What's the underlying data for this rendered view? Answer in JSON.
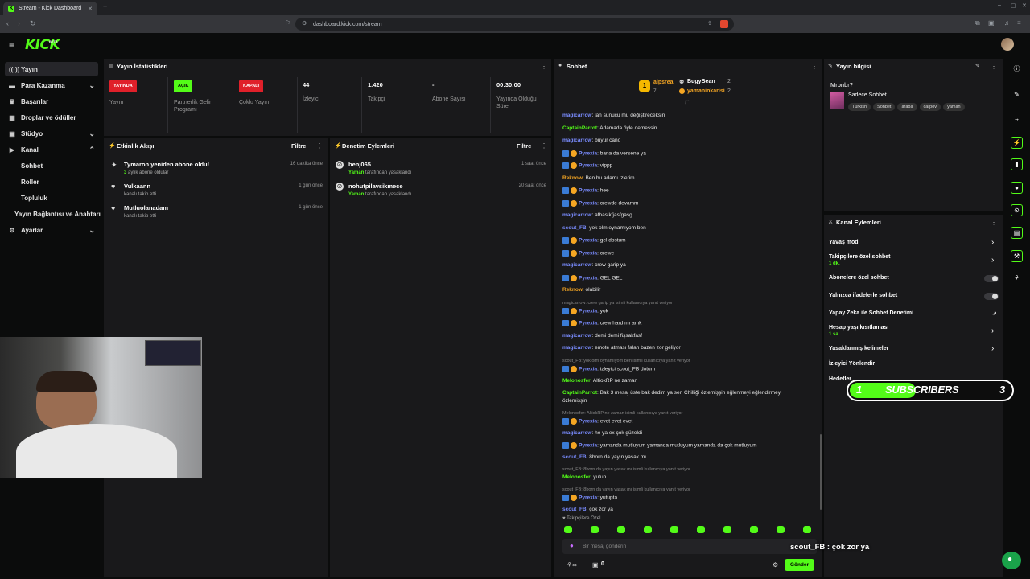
{
  "browser": {
    "tab_title": "Stream - Kick Dashboard",
    "url": "dashboard.kick.com/stream"
  },
  "brand": {
    "logo": "KICK",
    "accent": "#53fc18"
  },
  "sidebar": {
    "items": [
      {
        "label": "Yayın",
        "icon": "broadcast-icon"
      },
      {
        "label": "Para Kazanma",
        "icon": "money-icon"
      },
      {
        "label": "Başarılar",
        "icon": "trophy-icon"
      },
      {
        "label": "Droplar ve ödüller",
        "icon": "gift-icon"
      },
      {
        "label": "Stüdyo",
        "icon": "studio-icon"
      },
      {
        "label": "Kanal",
        "icon": "channel-icon"
      },
      {
        "label": "Ayarlar",
        "icon": "gear-icon"
      }
    ],
    "sub": [
      "Sohbet",
      "Roller",
      "Topluluk",
      "Yayın Bağlantısı ve Anahtarı"
    ]
  },
  "stats": {
    "title": "Yayın İstatistikleri",
    "items": [
      {
        "value": "YAYINDA",
        "label": "Yayın"
      },
      {
        "value": "AÇIK",
        "label": "Partnerlik Gelir Programı"
      },
      {
        "value": "KAPALI",
        "label": "Çoklu Yayın"
      },
      {
        "value": "44",
        "label": "İzleyici"
      },
      {
        "value": "1.420",
        "label": "Takipçi"
      },
      {
        "value": "-",
        "label": "Abone Sayısı"
      },
      {
        "value": "00:30:00",
        "label": "Yayında Olduğu Süre"
      }
    ]
  },
  "activity": {
    "title": "Etkinlik Akışı",
    "filter": "Filtre",
    "items": [
      {
        "name": "Tymaron yeniden abone oldu!",
        "sub_num": "3",
        "sub": " aylık abone oldular",
        "time": "16 dakika önce"
      },
      {
        "name": "Vulkaann",
        "sub": "kanalı takip etti",
        "time": "1 gün önce"
      },
      {
        "name": "Mutluolanadam",
        "sub": "kanalı takip etti",
        "time": "1 gün önce"
      }
    ]
  },
  "moderation": {
    "title": "Denetim Eylemleri",
    "filter": "Filtre",
    "items": [
      {
        "name": "benj065",
        "by": "Yaman",
        "sub": " tarafından yasaklandı",
        "time": "1 saat önce"
      },
      {
        "name": "nohutpilavsikmece",
        "by": "Yaman",
        "sub": " tarafından yasaklandı",
        "time": "20 saat önce"
      }
    ]
  },
  "chat": {
    "title": "Sohbet",
    "leaders": [
      {
        "rank": "1",
        "name": "alpsreal",
        "count": "7"
      },
      {
        "name": "BugyBean",
        "count": "2"
      },
      {
        "name": "yamaninkarisi",
        "count": "2"
      }
    ],
    "messages": [
      {
        "u": "magicarrow",
        "c": "#7a8cff",
        "t": ": lan sunucu mu değiştireceksin"
      },
      {
        "u": "CaptainParrot",
        "c": "#53fc18",
        "t": ": Adamada öyle demessin"
      },
      {
        "u": "magicarrow",
        "c": "#7a8cff",
        "t": ": buyur cano"
      },
      {
        "u": "Pyrexia",
        "c": "#7a8cff",
        "t": ": bana da versene ya",
        "b": true
      },
      {
        "u": "Pyrexia",
        "c": "#7a8cff",
        "t": ": vippp",
        "b": true
      },
      {
        "u": "Reknow",
        "c": "#f5a623",
        "t": ": Ben bu adamı izlerim"
      },
      {
        "u": "Pyrexia",
        "c": "#7a8cff",
        "t": ": hee",
        "b": true
      },
      {
        "u": "Pyrexia",
        "c": "#7a8cff",
        "t": ": crewde devamm",
        "b": true
      },
      {
        "u": "magicarrow",
        "c": "#7a8cff",
        "t": ": afhasikfjasfgasg"
      },
      {
        "u": "scout_FB",
        "c": "#7a8cff",
        "t": ": yok olm oynamıyom ben"
      },
      {
        "u": "Pyrexia",
        "c": "#7a8cff",
        "t": ": gel dostum",
        "b": true
      },
      {
        "u": "Pyrexia",
        "c": "#7a8cff",
        "t": ": crewe",
        "b": true
      },
      {
        "u": "magicarrow",
        "c": "#7a8cff",
        "t": ": crew garip ya"
      },
      {
        "u": "Pyrexia",
        "c": "#7a8cff",
        "t": ": GEL GEL",
        "b": true
      },
      {
        "u": "Reknow",
        "c": "#f5a623",
        "t": ": olabilir"
      },
      {
        "reply": "magicarrow: crew garip ya isimli kullanıcıya yanıt veriyor"
      },
      {
        "u": "Pyrexia",
        "c": "#7a8cff",
        "t": ": yok",
        "b": true
      },
      {
        "u": "Pyrexia",
        "c": "#7a8cff",
        "t": ": crew hard mı amk",
        "b": true
      },
      {
        "u": "magicarrow",
        "c": "#7a8cff",
        "t": ": demi demi fişsakfasf"
      },
      {
        "u": "magicarrow",
        "c": "#7a8cff",
        "t": ": emote atması falan bazen zor geliyor"
      },
      {
        "reply": "scout_FB: yok olm oynamıyom ben isimli kullanıcıya yanıt veriyor"
      },
      {
        "u": "Pyrexia",
        "c": "#7a8cff",
        "t": ": izleyici scout_FB dotum",
        "b": true
      },
      {
        "u": "Melonosfer",
        "c": "#53fc18",
        "t": ": AltiokRP ne zaman"
      },
      {
        "u": "CaptainParrot",
        "c": "#53fc18",
        "t": ": Bak 3 mesaj üste bak dedim ya sen Chilliği özlemişşin eğlenmeyi eğlendirmeyi",
        "t2": "özlemişşin"
      },
      {
        "reply": "Melonosfer: AltiokRP ne zaman isimli kullanıcıya yanıt veriyor"
      },
      {
        "u": "Pyrexia",
        "c": "#7a8cff",
        "t": ": evet evet evet",
        "b": true
      },
      {
        "u": "magicarrow",
        "c": "#7a8cff",
        "t": ": he ya ex çok güzeldi"
      },
      {
        "u": "Pyrexia",
        "c": "#7a8cff",
        "t": ": yamanda mutluyum yamanda mutluyum yamanda da çok mutluyum",
        "b": true
      },
      {
        "u": "scout_FB",
        "c": "#7a8cff",
        "t": ": 8born da yayın yasak mı"
      },
      {
        "reply": "scout_FB: 8born da yayın yasak mı isimli kullanıcıya yanıt veriyor"
      },
      {
        "u": "Melonosfer",
        "c": "#53fc18",
        "t": ": yutup"
      },
      {
        "reply": "scout_FB: 8born da yayın yasak mı isimli kullanıcıya yanıt veriyor"
      },
      {
        "u": "Pyrexia",
        "c": "#7a8cff",
        "t": ": yutupta",
        "b": true
      },
      {
        "u": "scout_FB",
        "c": "#7a8cff",
        "t": ": çok zor ya"
      }
    ],
    "followers_only": "Takipçilere Özel",
    "input_placeholder": "Bir mesaj gönderin",
    "send_label": "Gönder",
    "bottom_count": "0"
  },
  "stream_info": {
    "title": "Yayın bilgisi",
    "stream_title": "Mrbnbr?",
    "category": "Sadece Sohbet",
    "tags": [
      "Türkish",
      "Sohbet",
      "araba",
      "carpov",
      "yaman"
    ]
  },
  "channel_actions": {
    "title": "Kanal Eylemleri",
    "items": [
      {
        "label": "Yavaş mod",
        "type": "chevron"
      },
      {
        "label": "Takipçilere özel sohbet",
        "sub": "1 dk.",
        "type": "chevron"
      },
      {
        "label": "Abonelere özel sohbet",
        "type": "toggle"
      },
      {
        "label": "Yalnızca ifadelerle sohbet",
        "type": "toggle"
      },
      {
        "label": "Yapay Zeka ile Sohbet Denetimi",
        "type": "external"
      },
      {
        "label": "Hesap yaşı kısıtlaması",
        "sub": "1 sa.",
        "type": "chevron"
      },
      {
        "label": "Yasaklanmış kelimeler",
        "type": "chevron"
      },
      {
        "label": "İzleyici Yönlendir",
        "type": "none"
      },
      {
        "label": "Hedefler",
        "type": "none"
      }
    ]
  },
  "overlay": {
    "subs_left": "1",
    "subs_label": "SUBSCRIBERS",
    "subs_right": "3",
    "caption_user": "scout_FB",
    "caption_text": " : çok zor ya"
  }
}
